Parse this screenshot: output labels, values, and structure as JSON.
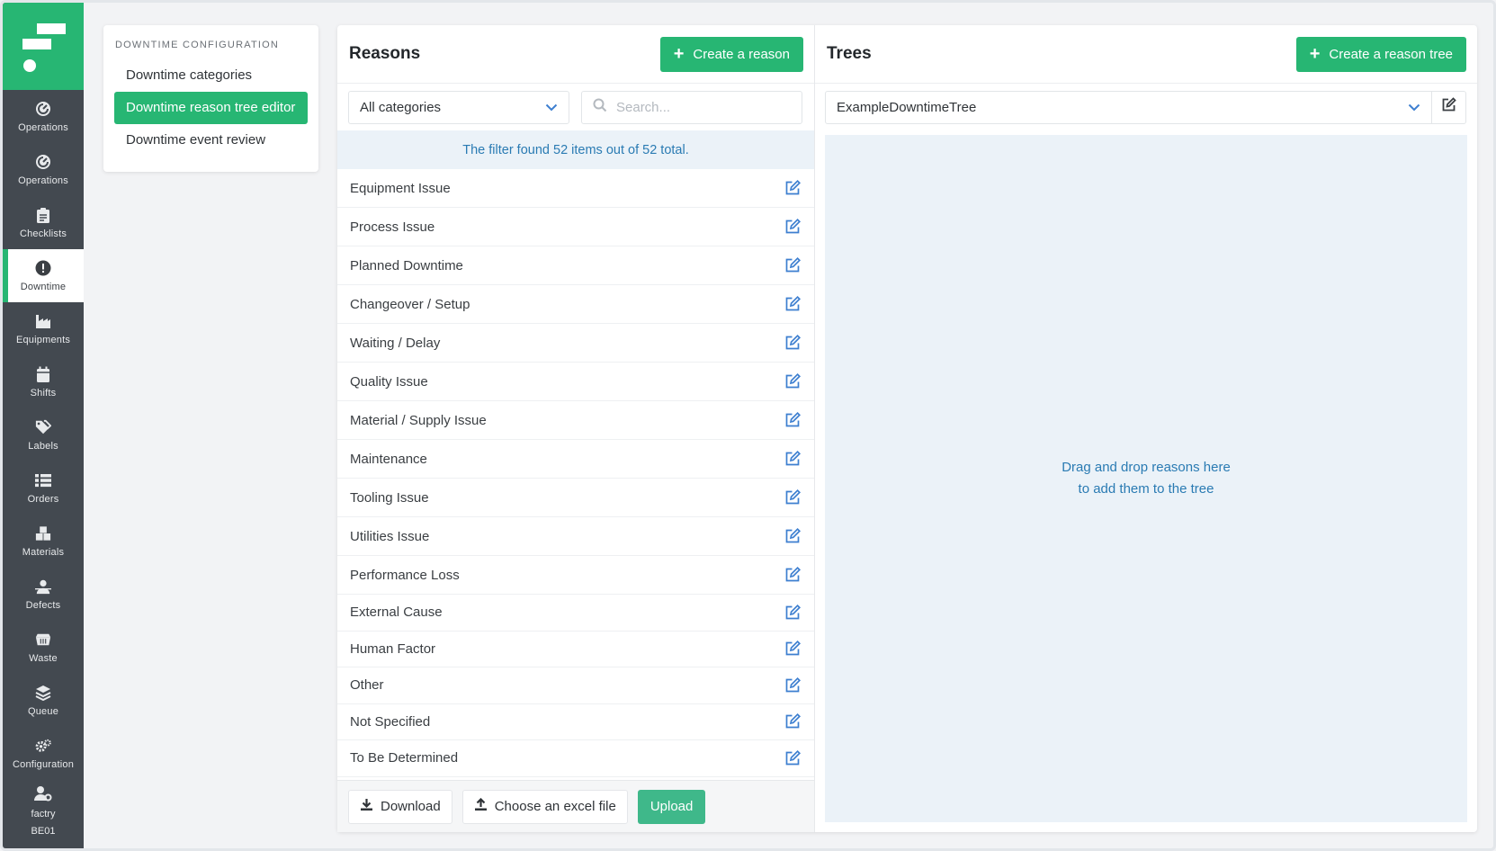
{
  "sidebar": {
    "items": [
      {
        "label": "Operations",
        "icon": "operations-icon"
      },
      {
        "label": "Operations",
        "icon": "operations-icon"
      },
      {
        "label": "Checklists",
        "icon": "clipboard-icon"
      },
      {
        "label": "Downtime",
        "icon": "exclamation-icon",
        "active": true
      },
      {
        "label": "Equipments",
        "icon": "factory-icon"
      },
      {
        "label": "Shifts",
        "icon": "calendar-icon"
      },
      {
        "label": "Labels",
        "icon": "tags-icon"
      },
      {
        "label": "Orders",
        "icon": "list-icon"
      },
      {
        "label": "Materials",
        "icon": "boxes-icon"
      },
      {
        "label": "Defects",
        "icon": "person-icon"
      },
      {
        "label": "Waste",
        "icon": "dumpster-icon"
      },
      {
        "label": "Queue",
        "icon": "layers-icon"
      },
      {
        "label": "Configuration",
        "icon": "gears-icon"
      }
    ],
    "user": {
      "name": "factry",
      "site": "BE01"
    }
  },
  "config": {
    "heading": "DOWNTIME CONFIGURATION",
    "items": [
      {
        "label": "Downtime categories"
      },
      {
        "label": "Downtime reason tree editor",
        "active": true
      },
      {
        "label": "Downtime event review"
      }
    ]
  },
  "reasons": {
    "title": "Reasons",
    "create_label": "Create a reason",
    "category_select": "All categories",
    "search_placeholder": "Search...",
    "filter_info": "The filter found 52 items out of 52 total.",
    "items": [
      "Equipment Issue",
      "Process Issue",
      "Planned Downtime",
      "Changeover / Setup",
      "Waiting / Delay",
      "Quality Issue",
      "Material / Supply Issue",
      "Maintenance",
      "Tooling Issue",
      "Utilities Issue",
      "Performance Loss",
      "External Cause",
      "Human Factor",
      "Other",
      "Not Specified",
      "To Be Determined"
    ],
    "download_label": "Download",
    "choose_file_label": "Choose an excel file",
    "upload_label": "Upload"
  },
  "trees": {
    "title": "Trees",
    "create_label": "Create a reason tree",
    "selected_tree": "ExampleDowntimeTree",
    "dropzone_line1": "Drag and drop reasons here",
    "dropzone_line2": "to add them to the tree"
  },
  "colors": {
    "accent": "#27b673",
    "sidebar": "#434950",
    "info": "#2a7bb3",
    "edit_icon": "#3d7fd0"
  }
}
